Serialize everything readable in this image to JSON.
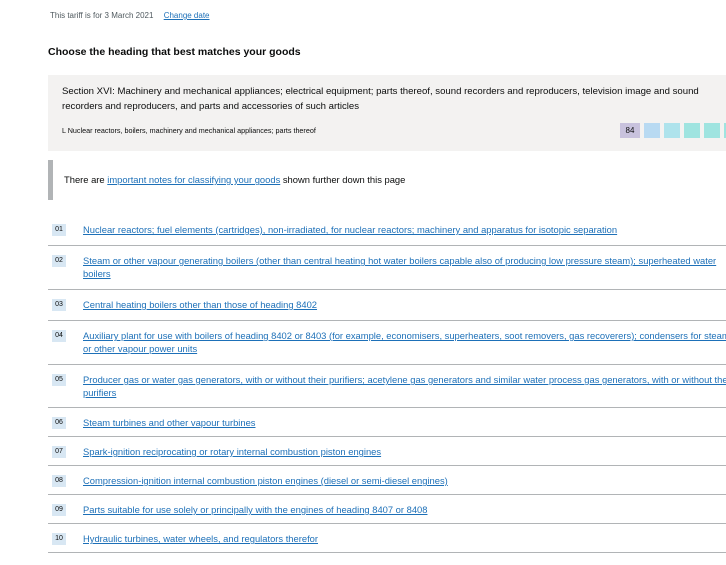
{
  "tariff": {
    "date_text": "This tariff is for 3 March 2021",
    "change_date_label": "Change date"
  },
  "page_heading": "Choose the heading that best matches your goods",
  "section": {
    "title": "Section XVI: Machinery and mechanical appliances; electrical equipment; parts thereof, sound recorders and reproducers, television image and sound recorders and reproducers, and parts and accessories of such articles",
    "chapter": "L Nuclear reactors, boilers, machinery and mechanical appliances; parts thereof",
    "chapter_code": "84",
    "code_colors": [
      "#b8daf2",
      "#aee3ec",
      "#9fe4e0",
      "#9fe4e0",
      "#9fe4e0"
    ]
  },
  "notes": {
    "prefix": "There are ",
    "link": "important notes for classifying your goods",
    "suffix": " shown further down this page"
  },
  "headings": [
    {
      "num": "01",
      "text": "Nuclear reactors; fuel elements (cartridges), non-irradiated, for nuclear reactors; machinery and apparatus for isotopic separation"
    },
    {
      "num": "02",
      "text": "Steam or other vapour generating boilers (other than central heating hot water boilers capable also of producing low pressure steam); superheated water boilers"
    },
    {
      "num": "03",
      "text": "Central heating boilers other than those of heading 8402"
    },
    {
      "num": "04",
      "text": "Auxiliary plant for use with boilers of heading 8402 or 8403 (for example, economisers, superheaters, soot removers, gas recoverers); condensers for steam or other vapour power units"
    },
    {
      "num": "05",
      "text": "Producer gas or water gas generators, with or without their purifiers; acetylene gas generators and similar water process gas generators, with or without their purifiers"
    },
    {
      "num": "06",
      "text": "Steam turbines and other vapour turbines"
    },
    {
      "num": "07",
      "text": "Spark-ignition reciprocating or rotary internal combustion piston engines"
    },
    {
      "num": "08",
      "text": "Compression-ignition internal combustion piston engines (diesel or semi-diesel engines)"
    },
    {
      "num": "09",
      "text": "Parts suitable for use solely or principally with the engines of heading 8407 or 8408"
    },
    {
      "num": "10",
      "text": "Hydraulic turbines, water wheels, and regulators therefor"
    }
  ]
}
